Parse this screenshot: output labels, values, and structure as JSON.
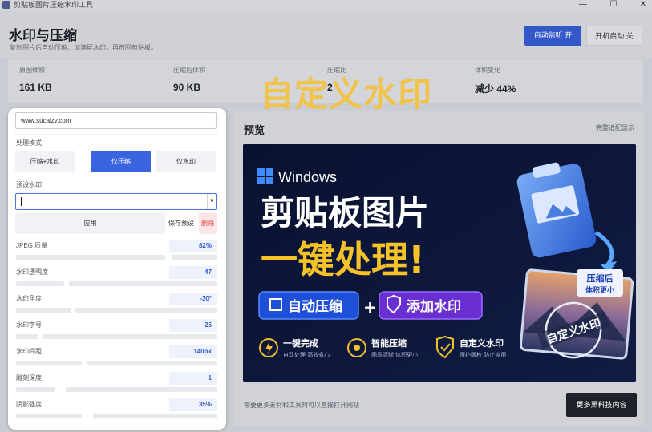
{
  "window": {
    "title": "剪贴板图片压缩水印工具",
    "minimize": "—",
    "maximize": "☐",
    "close": "✕"
  },
  "header": {
    "title": "水印与压缩",
    "subtitle": "复制图片后自动压缩、加满屏水印，再放回剪贴板。",
    "auto_monitor": "自动监听 开",
    "boot_start": "开机启动 关"
  },
  "stats": [
    {
      "label": "原图体积",
      "value": "161 KB"
    },
    {
      "label": "压缩后体积",
      "value": "90 KB"
    },
    {
      "label": "压缩比",
      "value": "2"
    },
    {
      "label": "体积变化",
      "value": "减少 44%"
    }
  ],
  "overlay_caption": "自定义水印",
  "panel": {
    "watermark_text": "www.sucaizy.com",
    "mode_label": "处理模式",
    "modes": [
      "压缩+水印",
      "仅压缩",
      "仅水印"
    ],
    "active_mode": "仅压缩",
    "preset_label": "预设水印",
    "apply": "应用",
    "save_preset": "保存预设",
    "delete": "删除",
    "sliders": [
      {
        "label": "JPEG 质量",
        "value": "82%"
      },
      {
        "label": "水印透明度",
        "value": "47"
      },
      {
        "label": "水印角度",
        "value": "-30°"
      },
      {
        "label": "水印字号",
        "value": "25"
      },
      {
        "label": "水印间距",
        "value": "140px"
      },
      {
        "label": "雕刻深度",
        "value": "1"
      },
      {
        "label": "阴影强度",
        "value": "35%"
      }
    ]
  },
  "preview": {
    "title": "预览",
    "fit_label": "完整适配显示",
    "hint": "需要更多素材和工具时可以直接打开网站",
    "more_button": "更多黑科技内容",
    "banner": {
      "brand": "Windows",
      "headline1": "剪贴板图片",
      "headline2": "一键处理!",
      "pill1": "自动压缩",
      "plus": "+",
      "pill2": "添加水印",
      "badge_line1": "压缩后",
      "badge_line2": "体积更小",
      "stamp": "自定义水印",
      "features": [
        {
          "title": "一键完成",
          "desc": "自动处理 高效省心"
        },
        {
          "title": "智能压缩",
          "desc": "画质清晰 体积更小"
        },
        {
          "title": "自定义水印",
          "desc": "保护版权 防止盗用"
        }
      ]
    }
  }
}
